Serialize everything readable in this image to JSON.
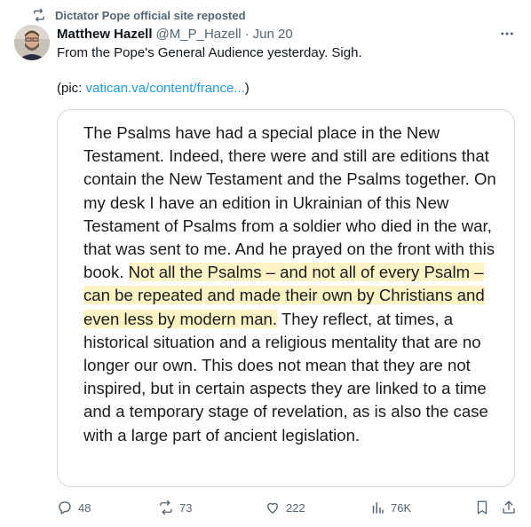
{
  "repost": {
    "label": "Dictator Pope official site reposted",
    "icon": "repost-icon"
  },
  "author": {
    "name": "Matthew Hazell",
    "handle": "@M_P_Hazell",
    "separator": "·",
    "date": "Jun 20"
  },
  "tweet": {
    "line1": "From the Pope's General Audience yesterday. Sigh.",
    "pic_prefix": "(pic: ",
    "pic_link": "vatican.va/content/france...",
    "pic_suffix": ")"
  },
  "media": {
    "text_before": "The Psalms have had a special place in the New Testament. Indeed, there were and still are editions that contain the New Testament and the Psalms together. On my desk I have an edition in Ukrainian of this New Testament of Psalms from a soldier who died in the war, that was sent to me. And he prayed on the front with this book. ",
    "text_highlight": "Not all the Psalms – and not all of every Psalm – can be repeated and made their own by Christians and even less by modern man.",
    "text_after": " They reflect, at times, a historical situation and a religious mentality that are no longer our own. This does not mean that they are not inspired, but in certain aspects they are linked to a time and a temporary stage of revelation, as is also the case with a large part of ancient legislation.",
    "highlight_color": "#fdf3c4"
  },
  "actions": {
    "replies": "48",
    "reposts": "73",
    "likes": "222",
    "views": "76K"
  },
  "colors": {
    "text": "#0f1419",
    "muted": "#536471",
    "link": "#1d9bf0",
    "border": "#cfd9de"
  }
}
